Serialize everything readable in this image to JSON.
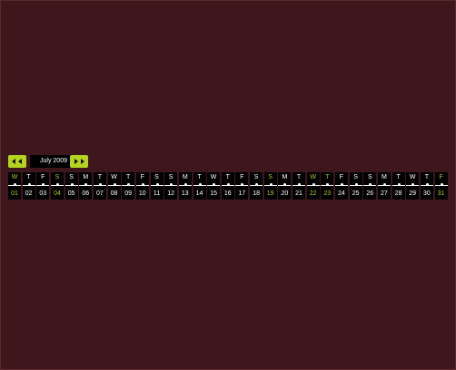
{
  "calendar": {
    "month_label": "July 2009",
    "accent_color": "#a8cf1a",
    "prev_icon": "double-arrow-left-icon",
    "next_icon": "double-arrow-right-icon",
    "days": [
      {
        "dow": "W",
        "num": "01",
        "hl": true
      },
      {
        "dow": "T",
        "num": "02",
        "hl": false
      },
      {
        "dow": "F",
        "num": "03",
        "hl": false
      },
      {
        "dow": "S",
        "num": "04",
        "hl": true
      },
      {
        "dow": "S",
        "num": "05",
        "hl": false
      },
      {
        "dow": "M",
        "num": "06",
        "hl": false
      },
      {
        "dow": "T",
        "num": "07",
        "hl": false
      },
      {
        "dow": "W",
        "num": "08",
        "hl": false
      },
      {
        "dow": "T",
        "num": "09",
        "hl": false
      },
      {
        "dow": "F",
        "num": "10",
        "hl": false
      },
      {
        "dow": "S",
        "num": "11",
        "hl": false
      },
      {
        "dow": "S",
        "num": "12",
        "hl": false
      },
      {
        "dow": "M",
        "num": "13",
        "hl": false
      },
      {
        "dow": "T",
        "num": "14",
        "hl": false
      },
      {
        "dow": "W",
        "num": "15",
        "hl": false
      },
      {
        "dow": "T",
        "num": "16",
        "hl": false
      },
      {
        "dow": "F",
        "num": "17",
        "hl": false
      },
      {
        "dow": "S",
        "num": "18",
        "hl": false
      },
      {
        "dow": "S",
        "num": "19",
        "hl": true
      },
      {
        "dow": "M",
        "num": "20",
        "hl": false
      },
      {
        "dow": "T",
        "num": "21",
        "hl": false
      },
      {
        "dow": "W",
        "num": "22",
        "hl": true
      },
      {
        "dow": "T",
        "num": "23",
        "hl": true
      },
      {
        "dow": "F",
        "num": "24",
        "hl": false
      },
      {
        "dow": "S",
        "num": "25",
        "hl": false
      },
      {
        "dow": "S",
        "num": "26",
        "hl": false
      },
      {
        "dow": "M",
        "num": "27",
        "hl": false
      },
      {
        "dow": "T",
        "num": "28",
        "hl": false
      },
      {
        "dow": "W",
        "num": "29",
        "hl": false
      },
      {
        "dow": "T",
        "num": "30",
        "hl": false
      },
      {
        "dow": "F",
        "num": "31",
        "hl": true
      }
    ]
  }
}
